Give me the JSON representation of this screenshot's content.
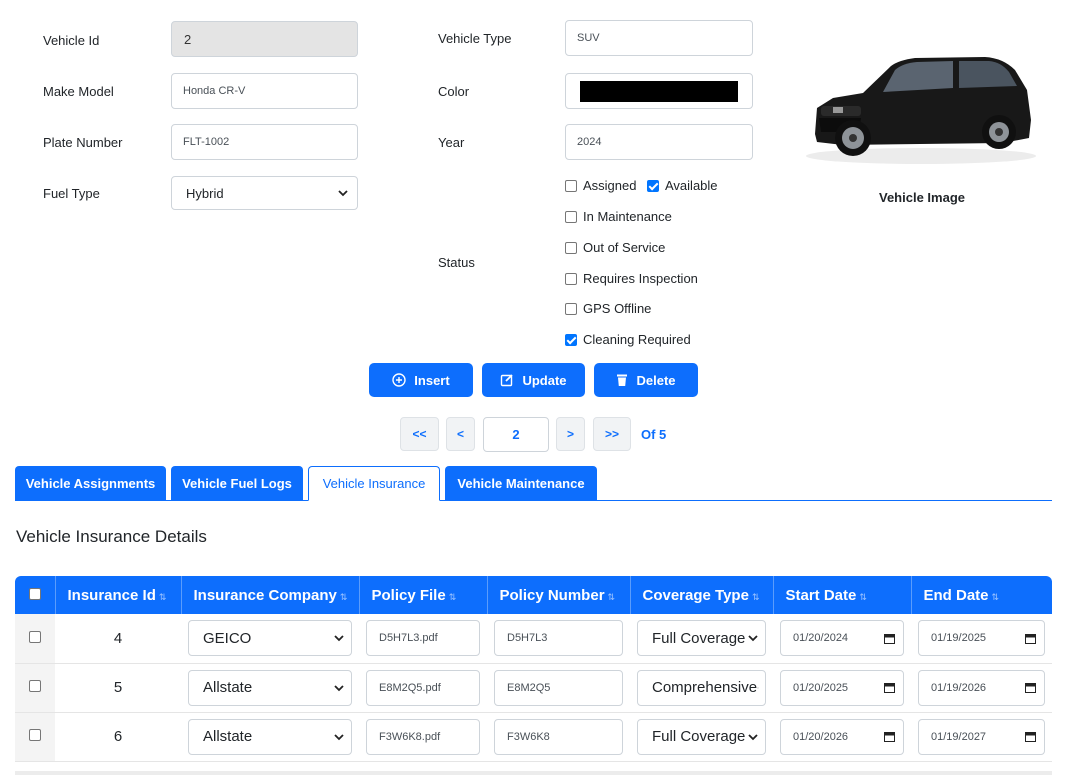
{
  "form": {
    "vehicle_id_label": "Vehicle Id",
    "vehicle_id_value": "2",
    "make_model_label": "Make Model",
    "make_model_value": "Honda CR-V",
    "plate_label": "Plate Number",
    "plate_value": "FLT-1002",
    "fuel_label": "Fuel Type",
    "fuel_value": "Hybrid",
    "type_label": "Vehicle Type",
    "type_value": "SUV",
    "color_label": "Color",
    "color_value": "#000000",
    "year_label": "Year",
    "year_value": "2024",
    "status_label": "Status",
    "image_caption": "Vehicle Image"
  },
  "status": [
    {
      "label": "Assigned",
      "checked": false
    },
    {
      "label": "Available",
      "checked": true
    },
    {
      "label": "In Maintenance",
      "checked": false
    },
    {
      "label": "Out of Service",
      "checked": false
    },
    {
      "label": "Requires Inspection",
      "checked": false
    },
    {
      "label": "GPS Offline",
      "checked": false
    },
    {
      "label": "Cleaning Required",
      "checked": true
    }
  ],
  "actions": {
    "insert": "Insert",
    "update": "Update",
    "delete": "Delete"
  },
  "pager": {
    "first": "<<",
    "prev": "<",
    "current": "2",
    "next": ">",
    "last": ">>",
    "of": "Of 5"
  },
  "tabs": [
    {
      "label": "Vehicle Assignments",
      "active": false
    },
    {
      "label": "Vehicle Fuel Logs",
      "active": false
    },
    {
      "label": "Vehicle Insurance",
      "active": true
    },
    {
      "label": "Vehicle Maintenance",
      "active": false
    }
  ],
  "section_title": "Vehicle Insurance Details",
  "table": {
    "columns": [
      "Insurance Id",
      "Insurance Company",
      "Policy File",
      "Policy Number",
      "Coverage Type",
      "Start Date",
      "End Date"
    ],
    "rows": [
      {
        "id": "4",
        "company": "GEICO",
        "file": "D5H7L3.pdf",
        "policy": "D5H7L3",
        "coverage": "Full Coverage",
        "start": "01/20/2024",
        "end": "01/19/2025"
      },
      {
        "id": "5",
        "company": "Allstate",
        "file": "E8M2Q5.pdf",
        "policy": "E8M2Q5",
        "coverage": "Comprehensive",
        "start": "01/20/2025",
        "end": "01/19/2026"
      },
      {
        "id": "6",
        "company": "Allstate",
        "file": "F3W6K8.pdf",
        "policy": "F3W6K8",
        "coverage": "Full Coverage",
        "start": "01/20/2026",
        "end": "01/19/2027"
      }
    ]
  },
  "colors": {
    "primary": "#0d6efd",
    "checkbox": "#0075ff"
  },
  "icons": {
    "insert": "plus-circle-icon",
    "update": "edit-icon",
    "delete": "trash-icon",
    "sort": "sort-icon",
    "calendar": "calendar-icon",
    "chevron": "chevron-down-icon"
  }
}
